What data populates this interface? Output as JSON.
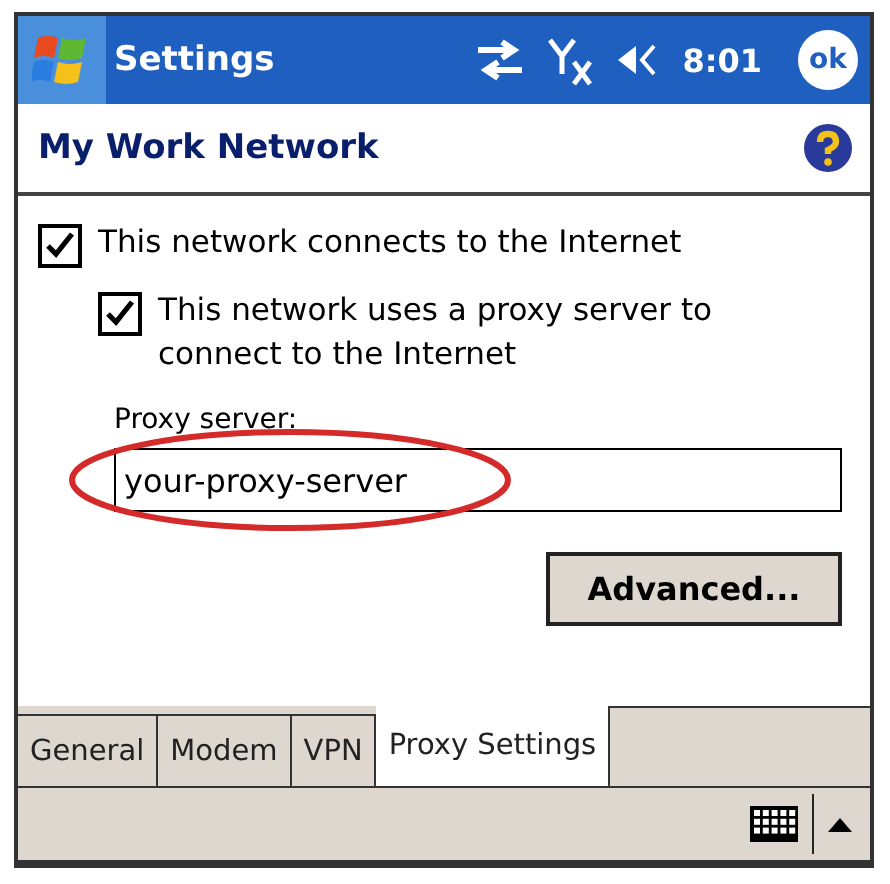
{
  "title_bar": {
    "title": "Settings",
    "time": "8:01",
    "ok_label": "ok"
  },
  "header": {
    "title": "My Work Network"
  },
  "options": [
    {
      "label": "This network connects to the Internet",
      "checked": true,
      "indented": false
    },
    {
      "label": "This network uses a proxy server to connect to the Internet",
      "checked": true,
      "indented": true
    }
  ],
  "proxy_server": {
    "label": "Proxy server:",
    "value": "your-proxy-server",
    "circled": true
  },
  "advanced_button": "Advanced...",
  "tabs": [
    {
      "label": "General",
      "selected": false
    },
    {
      "label": "Modem",
      "selected": false
    },
    {
      "label": "VPN",
      "selected": false
    },
    {
      "label": "Proxy Settings",
      "selected": true
    }
  ]
}
